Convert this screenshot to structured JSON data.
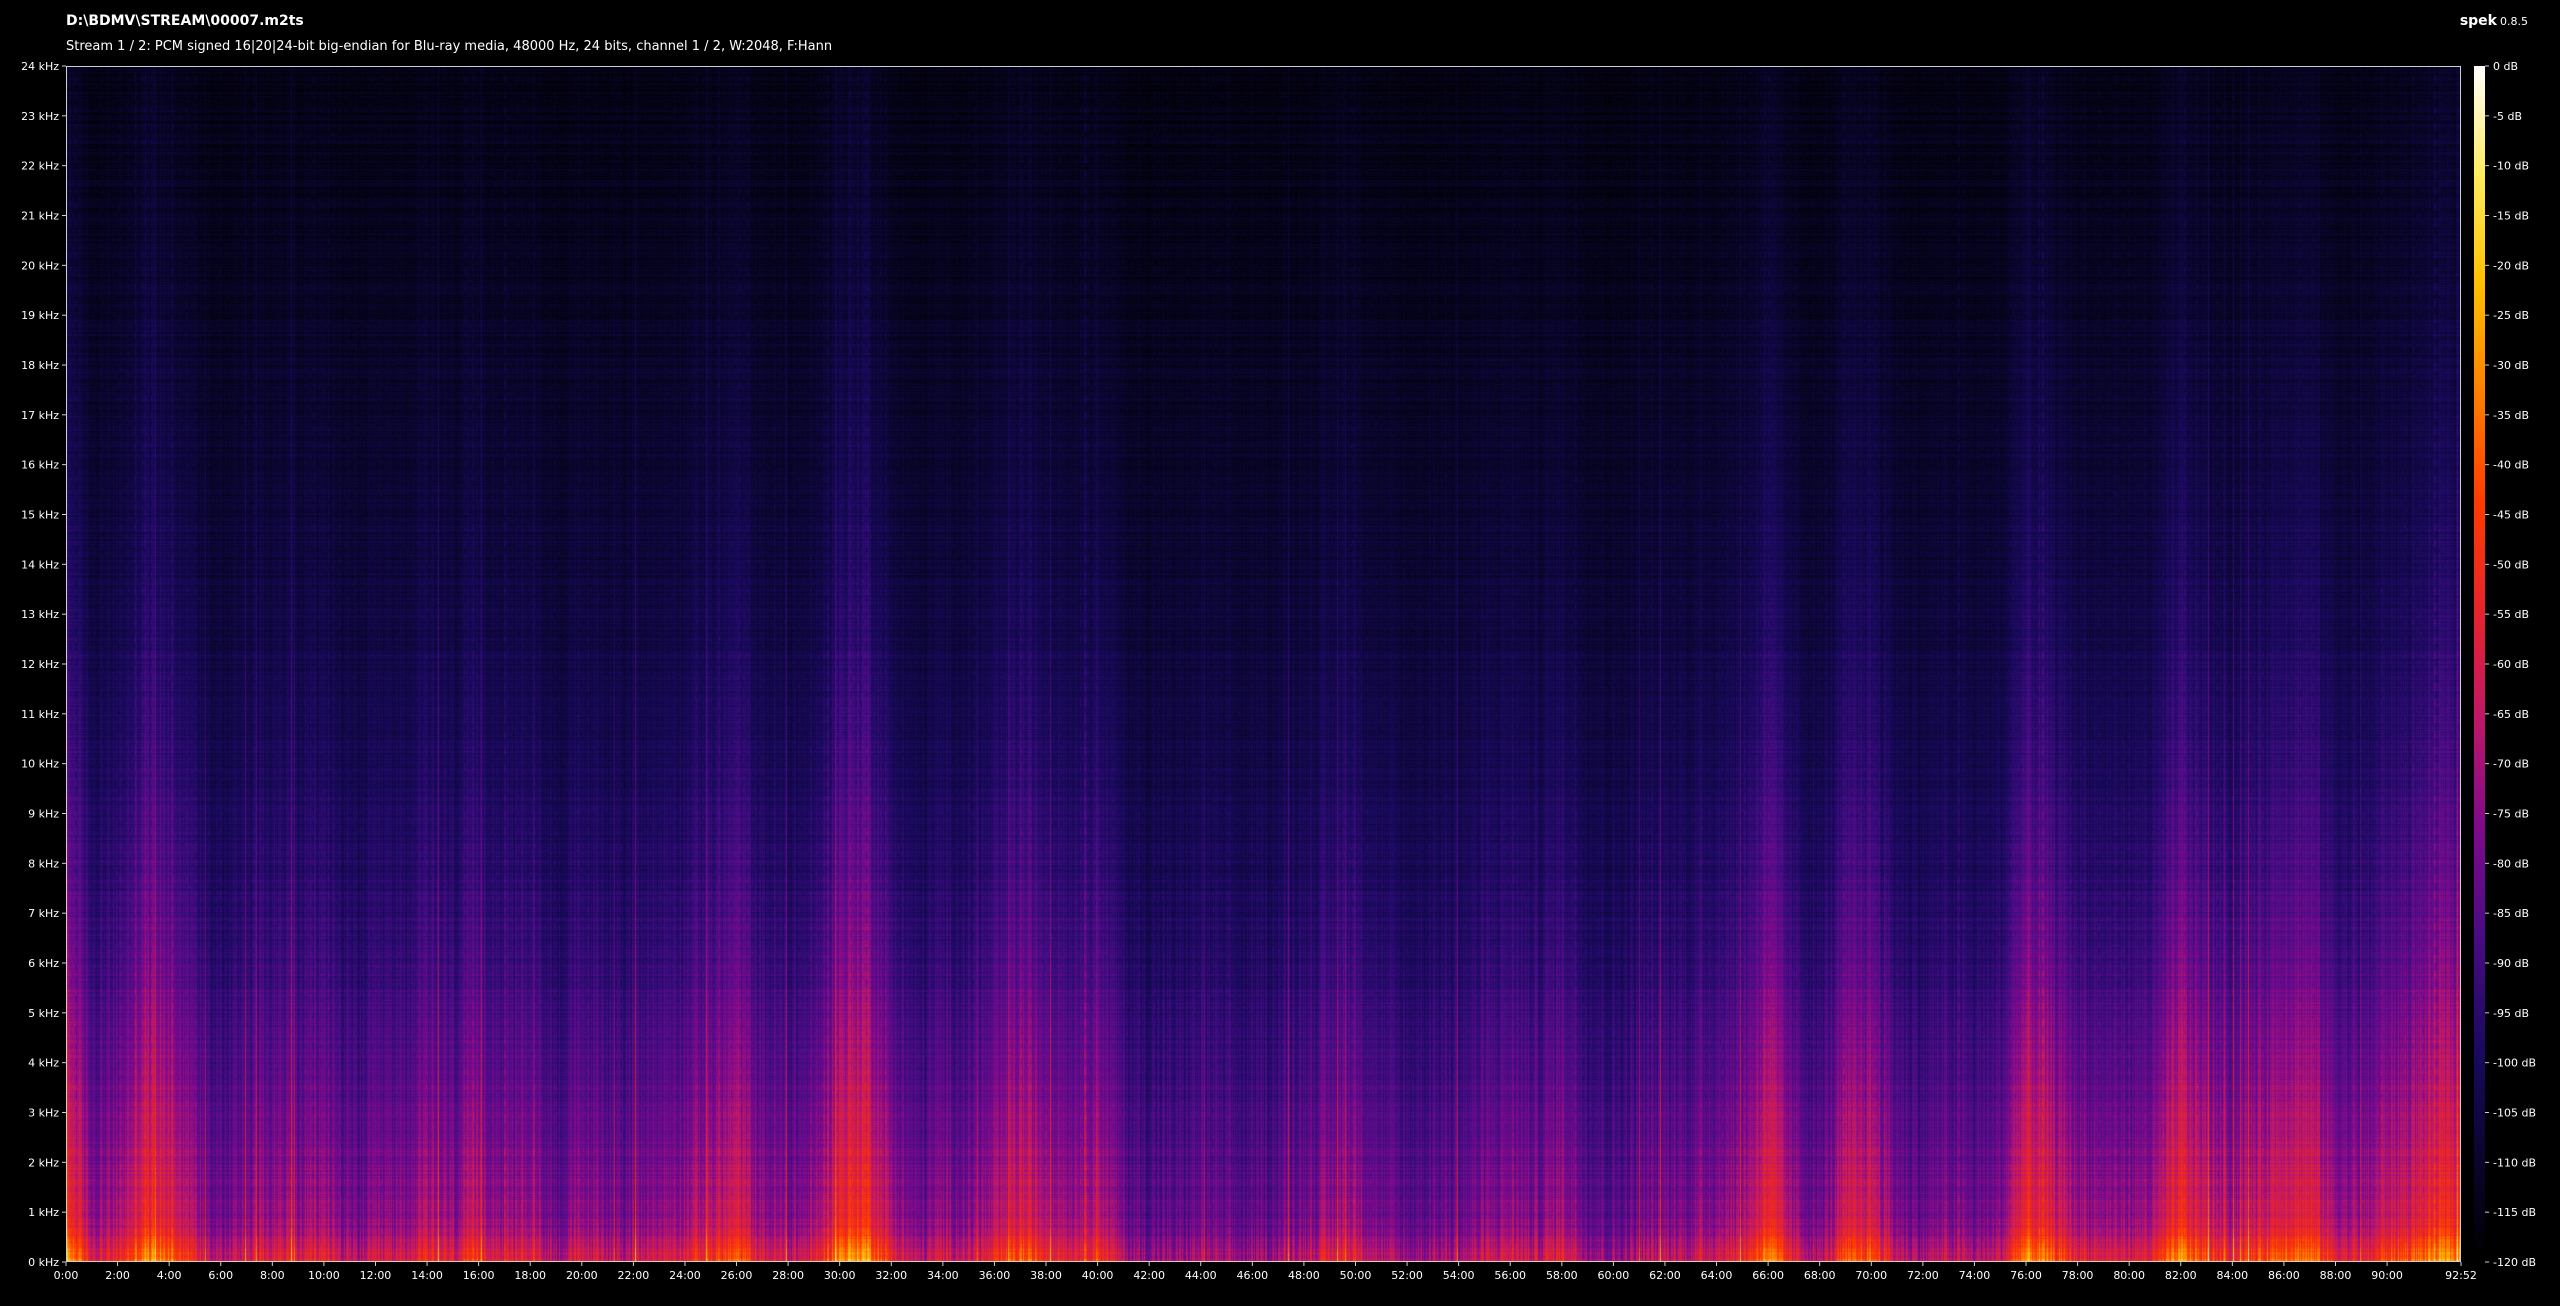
{
  "window": {
    "file_title": "D:\\BDMV\\STREAM\\00007.m2ts",
    "stream_info": "Stream 1 / 2: PCM signed 16|20|24-bit big-endian for Blu-ray media, 48000 Hz, 24 bits, channel 1 / 2, W:2048, F:Hann",
    "app_name": "spek",
    "app_version": "0.8.5"
  },
  "chart_data": {
    "type": "heatmap",
    "title": "",
    "xlabel": "",
    "ylabel": "",
    "x_tick_labels": [
      "0:00",
      "2:00",
      "4:00",
      "6:00",
      "8:00",
      "10:00",
      "12:00",
      "14:00",
      "16:00",
      "18:00",
      "20:00",
      "22:00",
      "24:00",
      "26:00",
      "28:00",
      "30:00",
      "32:00",
      "34:00",
      "36:00",
      "38:00",
      "40:00",
      "42:00",
      "44:00",
      "46:00",
      "48:00",
      "50:00",
      "52:00",
      "54:00",
      "56:00",
      "58:00",
      "60:00",
      "62:00",
      "64:00",
      "66:00",
      "68:00",
      "70:00",
      "72:00",
      "74:00",
      "76:00",
      "78:00",
      "80:00",
      "82:00",
      "84:00",
      "86:00",
      "88:00",
      "90:00",
      "92:52"
    ],
    "x_range_seconds": [
      0,
      5572
    ],
    "y_tick_labels": [
      "0 kHz",
      "1 kHz",
      "2 kHz",
      "3 kHz",
      "4 kHz",
      "5 kHz",
      "6 kHz",
      "7 kHz",
      "8 kHz",
      "9 kHz",
      "10 kHz",
      "11 kHz",
      "12 kHz",
      "13 kHz",
      "14 kHz",
      "15 kHz",
      "16 kHz",
      "17 kHz",
      "18 kHz",
      "19 kHz",
      "20 kHz",
      "21 kHz",
      "22 kHz",
      "23 kHz",
      "24 kHz"
    ],
    "y_range_khz": [
      0,
      24
    ],
    "colorbar": {
      "tick_labels": [
        "0 dB",
        "-5 dB",
        "-10 dB",
        "-15 dB",
        "-20 dB",
        "-25 dB",
        "-30 dB",
        "-35 dB",
        "-40 dB",
        "-45 dB",
        "-50 dB",
        "-55 dB",
        "-60 dB",
        "-65 dB",
        "-70 dB",
        "-75 dB",
        "-80 dB",
        "-85 dB",
        "-90 dB",
        "-95 dB",
        "-100 dB",
        "-105 dB",
        "-110 dB",
        "-115 dB",
        "-120 dB"
      ],
      "range_db": [
        -120,
        0
      ],
      "colors_bottom_to_top": [
        "#000000",
        "#0a0630",
        "#1c0a62",
        "#4a0c86",
        "#800a8c",
        "#c01868",
        "#e8242c",
        "#ff3c00",
        "#ff8000",
        "#ffc000",
        "#ffec60",
        "#ffffff"
      ]
    },
    "intensity_profile": {
      "time_minutes": [
        0,
        1,
        2,
        3,
        4,
        5,
        6,
        7,
        8,
        9,
        10,
        11,
        12,
        13,
        14,
        15,
        16,
        17,
        18,
        19,
        20,
        21,
        22,
        23,
        24,
        25,
        26,
        27,
        28,
        29,
        30,
        31,
        32,
        33,
        34,
        35,
        36,
        37,
        38,
        39,
        40,
        41,
        42,
        43,
        44,
        45,
        46,
        47,
        48,
        49,
        50,
        51,
        52,
        53,
        54,
        55,
        56,
        57,
        58,
        59,
        60,
        61,
        62,
        63,
        64,
        65,
        66,
        67,
        68,
        69,
        70,
        71,
        72,
        73,
        74,
        75,
        76,
        77,
        78,
        79,
        80,
        81,
        82,
        83,
        84,
        85,
        86,
        87,
        88,
        89,
        90,
        91,
        92
      ],
      "energy": [
        0.9,
        0.55,
        0.6,
        0.85,
        0.8,
        0.6,
        0.45,
        0.55,
        0.6,
        0.55,
        0.6,
        0.45,
        0.5,
        0.55,
        0.6,
        0.55,
        0.65,
        0.55,
        0.6,
        0.45,
        0.55,
        0.5,
        0.5,
        0.55,
        0.6,
        0.65,
        0.75,
        0.55,
        0.5,
        0.55,
        0.85,
        0.9,
        0.6,
        0.45,
        0.55,
        0.5,
        0.6,
        0.75,
        0.65,
        0.6,
        0.7,
        0.45,
        0.4,
        0.4,
        0.45,
        0.4,
        0.4,
        0.45,
        0.5,
        0.55,
        0.6,
        0.45,
        0.4,
        0.45,
        0.45,
        0.5,
        0.55,
        0.5,
        0.6,
        0.45,
        0.4,
        0.45,
        0.5,
        0.5,
        0.55,
        0.6,
        0.85,
        0.55,
        0.45,
        0.7,
        0.75,
        0.5,
        0.45,
        0.5,
        0.45,
        0.5,
        0.85,
        0.75,
        0.6,
        0.55,
        0.55,
        0.6,
        0.85,
        0.7,
        0.6,
        0.7,
        0.8,
        0.8,
        0.6,
        0.55,
        0.7,
        0.75,
        0.85
      ]
    }
  }
}
